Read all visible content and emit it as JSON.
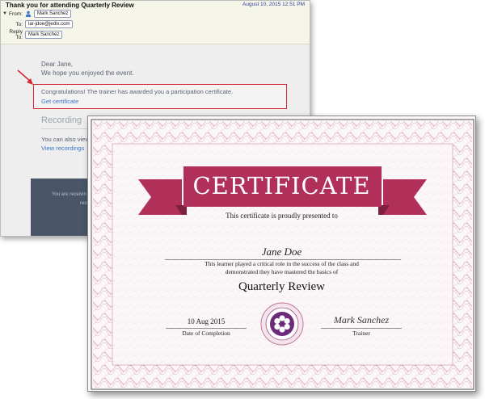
{
  "email": {
    "subject": "Thank you for attending Quarterly Review",
    "date": "August 10, 2015 12:51 PM",
    "from_label": "From:",
    "from_value": "Mark Sanchez",
    "to_label": "To:",
    "to_value": "lar-jdoe@jedix.com",
    "replyto_label": "Reply To:",
    "replyto_value": "Mark Sanchez",
    "greeting": "Dear Jane,",
    "line1": "We hope you enjoyed the event.",
    "congrats": "Congratulations! The trainer has awarded you a participation certificate.",
    "get_certificate": "Get certificate",
    "recording_title": "Recording",
    "recording_text": "You can also view",
    "view_recordings": "View recordings",
    "footer_line1": "You are receivin",
    "footer_line2": "rece"
  },
  "certificate": {
    "title": "CERTIFICATE",
    "presented": "This certificate is proudly presented to",
    "recipient": "Jane Doe",
    "desc_line1": "This learner played a critical role in the success of the class and",
    "desc_line2": "demonstrated they have mastered the basics of",
    "course": "Quarterly Review",
    "date_value": "10 Aug 2015",
    "date_label": "Date of Completion",
    "signature": "Mark Sanchez",
    "trainer_label": "Trainer"
  },
  "colors": {
    "ribbon": "#b0305a",
    "ribbon_dark": "#7e1f3e",
    "guilloche": "#b4466d",
    "seal": "#6b2a7a",
    "highlight_border": "#d32a34",
    "link": "#3d76c9"
  },
  "icons": [
    "caret-down-icon",
    "person-icon",
    "red-arrow-icon",
    "seal-flower-icon"
  ]
}
